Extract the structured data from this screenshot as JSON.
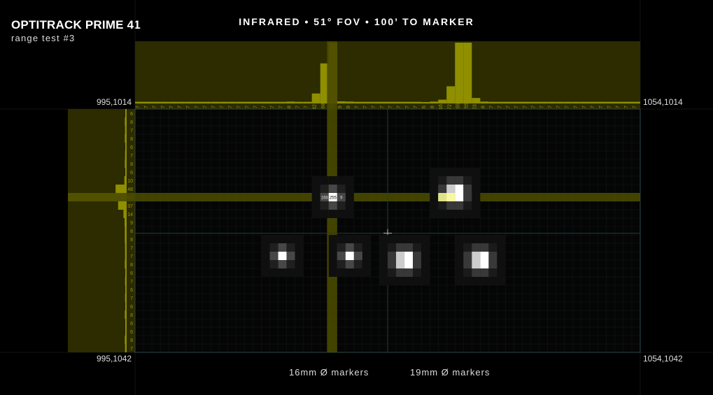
{
  "app": {
    "title": "OPTITRACK PRIME 41",
    "subtitle": "range test #3",
    "header": "INFRARED  •  51° FOV  •  100’ TO MARKER"
  },
  "corners": {
    "top_left": "995,1014",
    "top_right": "1054,1014",
    "bottom_left": "995,1042",
    "bottom_right": "1054,1042"
  },
  "legend": {
    "left": "16mm Ø markers",
    "right": "19mm Ø markers"
  },
  "sensor": {
    "columns": 60,
    "rows": 29,
    "selected_column": 23,
    "selected_row": 10,
    "column_profile": [
      "7",
      "7",
      "7",
      "7",
      "7",
      "7",
      "7",
      "7",
      "7",
      "7",
      "7",
      "7",
      "7",
      "7",
      "7",
      "7",
      "7",
      "7",
      "8",
      "7",
      "7",
      "42",
      "168",
      "255",
      "9",
      "8",
      "7",
      "7",
      "7",
      "7",
      "7",
      "7",
      "7",
      "7",
      "6",
      "8",
      "16",
      "72",
      "255",
      "255",
      "23",
      "8",
      "7",
      "7",
      "7",
      "7",
      "7",
      "7",
      "7",
      "7",
      "7",
      "7",
      "7",
      "7",
      "7",
      "7",
      "7",
      "7",
      "7",
      "7"
    ],
    "row_profile": [
      "6",
      "8",
      "7",
      "8",
      "6",
      "7",
      "8",
      "6",
      "10",
      "48",
      "255",
      "37",
      "14",
      "9",
      "8",
      "8",
      "7",
      "7",
      "8",
      "6",
      "7",
      "6",
      "7",
      "6",
      "8",
      "6",
      "6",
      "8",
      "7"
    ],
    "magnified_labels": [
      "168",
      "255",
      "9"
    ],
    "accent_color": "#8f8f00",
    "band_color": "#4a4a00"
  },
  "markers": [
    {
      "name": "marker-16mm-1",
      "col": 17.5,
      "row": 17.5,
      "peak": 255,
      "size": "16mm"
    },
    {
      "name": "marker-16mm-2",
      "col": 25.5,
      "row": 17.5,
      "peak": 255,
      "size": "16mm"
    },
    {
      "name": "marker-19mm-1",
      "col": 31.5,
      "row": 17.5,
      "peak": 255,
      "size": "19mm"
    },
    {
      "name": "marker-19mm-2",
      "col": 40.5,
      "row": 17.5,
      "peak": 255,
      "size": "19mm"
    },
    {
      "name": "marker-selected-row",
      "col": 37.5,
      "row": 10,
      "peak": 255,
      "size": "19mm"
    },
    {
      "name": "marker-selected-left",
      "col": 23,
      "row": 10,
      "peak": 255,
      "size": "16mm"
    }
  ]
}
